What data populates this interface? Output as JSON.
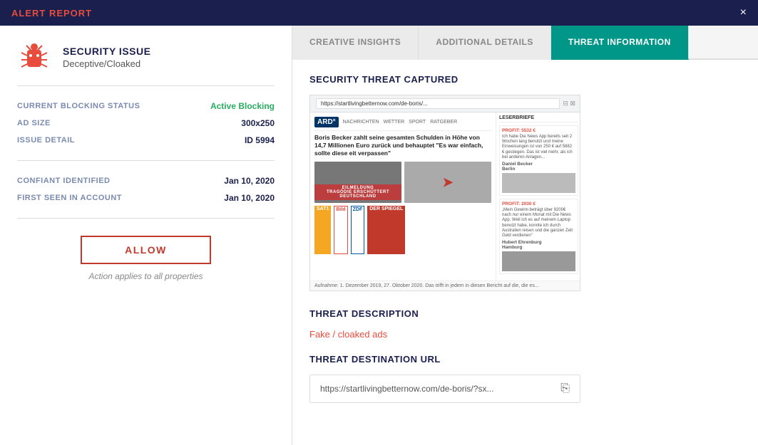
{
  "header": {
    "title": "ALERT",
    "title_highlight": "ALERT",
    "title_rest": " REPORT",
    "close_label": "×"
  },
  "left": {
    "issue_type": "SECURITY ISSUE",
    "issue_subtype": "Deceptive/Cloaked",
    "fields": [
      {
        "label": "CURRENT BLOCKING STATUS",
        "value": "Active Blocking",
        "value_class": "green"
      },
      {
        "label": "AD SIZE",
        "value": "300x250",
        "value_class": ""
      },
      {
        "label": "ISSUE DETAIL",
        "value": "ID 5994",
        "value_class": ""
      }
    ],
    "dates": [
      {
        "label": "CONFIANT IDENTIFIED",
        "value": "Jan 10, 2020"
      },
      {
        "label": "FIRST SEEN IN ACCOUNT",
        "value": "Jan 10, 2020"
      }
    ],
    "allow_button": "ALLOW",
    "allow_note": "Action applies to all properties"
  },
  "tabs": [
    {
      "label": "CREATIVE INSIGHTS",
      "active": false
    },
    {
      "label": "ADDITIONAL DETAILS",
      "active": false
    },
    {
      "label": "THREAT INFORMATION",
      "active": true
    }
  ],
  "right": {
    "threat_capture_title": "SECURITY THREAT CAPTURED",
    "screenshot_url": "https://startlivingbetternow.com/de-boris/?sx...",
    "ard_logo": "ARD°",
    "article_headline": "Boris Becker zahlt seine gesamten Schulden in Höhe von 14,7 Millionen Euro zurück und behauptet \"Es war einfach, sollte diese eit verpassen\"",
    "breaking_news": "EILMELDUNG\nTRAGÖDIE ERSCHÜTTERT DEUTSCHLAND",
    "sidebar_header": "LESERBRIEFE",
    "sidebar_cards": [
      {
        "profit_label": "PROFIT: 5532 €",
        "text": "Ich habe Die News App bereits seit 2 Wochen lang benutzt und meine Einweisungen ist von 250 € auf 5882 € gestiegen. Das ist viel mehr, als ich bei anderen Anlagen..."
      },
      {
        "profit_label": "PROFIT: 2030 €",
        "text": "Mein Gewinn beträgt über 9200€ nach nur einem Monat mit Die News App. Weil ich es auf meinem Laptop benutzt habe, konnte ich durch Australien reisen und die ganzen Zeit Geld verdienen"
      }
    ],
    "caption_text": "Aufnahme: 1. Dezember 2019, 27. Oktober 2020. Das trifft in jedem in diesen Bericht auf die, die es..."
  },
  "threat": {
    "description_title": "THREAT DESCRIPTION",
    "description_value": "Fake / cloaked ads",
    "destination_title": "THREAT DESTINATION URL",
    "destination_url": "https://startlivingbetternow.com/de-boris/?sx..."
  }
}
